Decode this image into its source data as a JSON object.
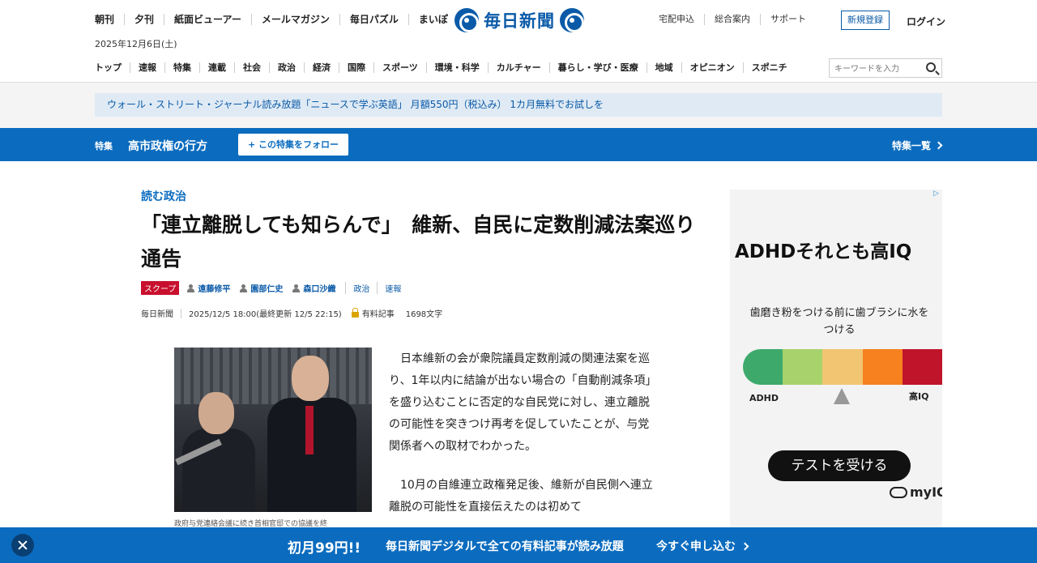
{
  "header": {
    "top_nav": [
      "朝刊",
      "夕刊",
      "紙面ビューアー",
      "メールマガジン",
      "毎日パズル",
      "まいぽ"
    ],
    "date": "2025年12月6日(土)",
    "logo": "毎日新聞",
    "utility_links": [
      "宅配申込",
      "総合案内",
      "サポート"
    ],
    "signup": "新規登録",
    "login": "ログイン",
    "main_nav": [
      "トップ",
      "速報",
      "特集",
      "連載",
      "社会",
      "政治",
      "経済",
      "国際",
      "スポーツ",
      "環境・科学",
      "カルチャー",
      "暮らし・学び・医療",
      "地域",
      "オピニオン",
      "スポニチ"
    ],
    "search_placeholder": "キーワードを入力"
  },
  "promo": "ウォール・ストリート・ジャーナル読み放題「ニュースで学ぶ英語」 月額550円（税込み） 1カ月無料でお試しを",
  "feature": {
    "tag": "特集",
    "title": "高市政権の行方",
    "follow": "+ この特集をフォロー",
    "list": "特集一覧"
  },
  "article": {
    "kicker": "読む政治",
    "headline": "「連立離脱しても知らんで」　維新、自民に定数削減法案巡り通告",
    "badge": "スクープ",
    "authors": [
      "遠藤修平",
      "園部仁史",
      "森口沙織"
    ],
    "categories": [
      "政治",
      "速報"
    ],
    "source": "毎日新聞",
    "timestamp": "2025/12/5 18:00(最終更新 12/5 22:15)",
    "paid": "有料記事",
    "char_count": "1698文字",
    "caption": "政府与党連絡会議に続き首相官邸での協議を終",
    "paragraphs": [
      "日本維新の会が衆院議員定数削減の関連法案を巡り、1年以内に結論が出ない場合の「自動削減条項」を盛り込むことに否定的な自民党に対し、連立離脱の可能性を突きつけ再考を促していたことが、与党関係者への取材でわかった。",
      "10月の自維連立政権発足後、維新が自民側へ連立離脱の可能性を直接伝えたのは初めて"
    ]
  },
  "ad": {
    "title": "ADHDそれとも高IQ",
    "question": "歯磨き粉をつける前に歯ブラシに水をつける",
    "left_label": "ADHD",
    "right_label": "高IQ",
    "button": "テストを受ける",
    "logo": "myIQ",
    "colors": [
      "#3daa6b",
      "#a8d26c",
      "#f2c572",
      "#f7801f",
      "#c0142b"
    ]
  },
  "bottom": {
    "price": "初月99円!!",
    "text": "毎日新聞デジタルで全ての有料記事が読み放題",
    "cta": "今すぐ申し込む"
  }
}
